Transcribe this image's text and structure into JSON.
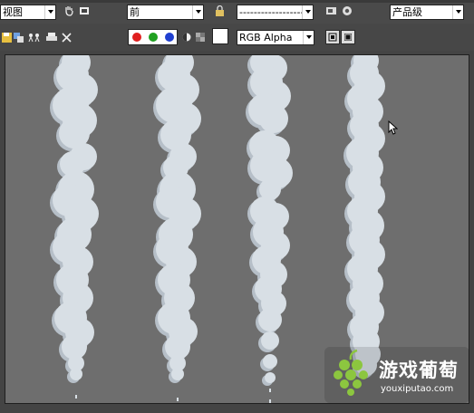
{
  "toolbar_top": {
    "view_select": "视图",
    "angle_select": "前",
    "preset_select": "--------------------",
    "quality_select": "产品级",
    "icons": [
      "pan-hand-icon",
      "copy-viewport-icon",
      "lock-icon",
      "render-setup-icon",
      "render-icon"
    ]
  },
  "toolbar_channels": {
    "icons": [
      "save-image-icon",
      "clone-window-icon",
      "channels-icon",
      "print-icon",
      "clear-icon"
    ],
    "channel_dots": [
      "#e02020",
      "#20a020",
      "#2040d0"
    ],
    "swatch_color": "#ffffff",
    "alpha_select": "RGB Alpha",
    "display_icons": [
      "display-alpha-icon",
      "display-mono-icon"
    ]
  },
  "viewport": {
    "background": "#6e6e6e",
    "smoke_color": "#d8dfe5",
    "smoke_shade": "#b6bfc8",
    "columns": [
      "smoke-column-1",
      "smoke-column-2",
      "smoke-column-3",
      "smoke-column-4"
    ]
  },
  "watermark": {
    "title": "游戏葡萄",
    "url": "youxiputao.com",
    "brand_color": "#8cc63f"
  }
}
